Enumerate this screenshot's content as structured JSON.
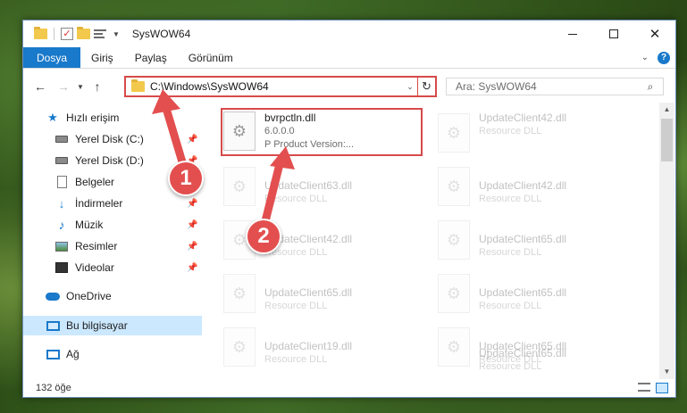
{
  "window": {
    "title": "SysWOW64"
  },
  "ribbon": {
    "tabs": [
      {
        "label": "Dosya"
      },
      {
        "label": "Giriş"
      },
      {
        "label": "Paylaş"
      },
      {
        "label": "Görünüm"
      }
    ],
    "help_label": "?"
  },
  "navbar": {
    "address": "C:\\Windows\\SysWOW64",
    "search_placeholder": "Ara: SysWOW64"
  },
  "sidebar": {
    "items": [
      {
        "label": "Hızlı erişim",
        "icon": "star-icon"
      },
      {
        "label": "Yerel Disk (C:)",
        "icon": "drive-icon",
        "pinned": true
      },
      {
        "label": "Yerel Disk (D:)",
        "icon": "drive-icon",
        "pinned": true
      },
      {
        "label": "Belgeler",
        "icon": "document-icon",
        "pinned": true
      },
      {
        "label": "İndirmeler",
        "icon": "download-icon",
        "pinned": true
      },
      {
        "label": "Müzik",
        "icon": "music-icon",
        "pinned": true
      },
      {
        "label": "Resimler",
        "icon": "picture-icon",
        "pinned": true
      },
      {
        "label": "Videolar",
        "icon": "video-icon",
        "pinned": true
      },
      {
        "label": "OneDrive",
        "icon": "cloud-icon"
      },
      {
        "label": "Bu bilgisayar",
        "icon": "computer-icon",
        "selected": true
      },
      {
        "label": "Ağ",
        "icon": "network-icon"
      }
    ]
  },
  "files": {
    "highlighted": {
      "name": "bvrpctln.dll",
      "version": "6.0.0.0",
      "description": "P  Product Version:..."
    },
    "left_column": [
      {
        "name": "UpdateClient63.dll",
        "description": "Resource DLL"
      },
      {
        "name": "UpdateClient42.dll",
        "description": "Resource DLL"
      },
      {
        "name": "UpdateClient65.dll",
        "description": "Resource DLL"
      },
      {
        "name": "UpdateClient19.dll",
        "description": "Resource DLL"
      }
    ],
    "right_column": [
      {
        "name": "UpdateClient42.dll",
        "description": "Resource DLL"
      },
      {
        "name": "UpdateClient42.dll",
        "description": "Resource DLL"
      },
      {
        "name": "UpdateClient65.dll",
        "description": "Resource DLL"
      },
      {
        "name": "UpdateClient65.dll",
        "description": "Resource DLL"
      },
      {
        "name": "UpdateClient65.dll",
        "description": "Resource DLL"
      },
      {
        "name": "UpdateClient65.dll",
        "description": "Resource DLL"
      }
    ]
  },
  "status": {
    "item_count": "132 öğe"
  },
  "annotations": {
    "step1": "1",
    "step2": "2",
    "accent_color": "#e34f4f"
  }
}
